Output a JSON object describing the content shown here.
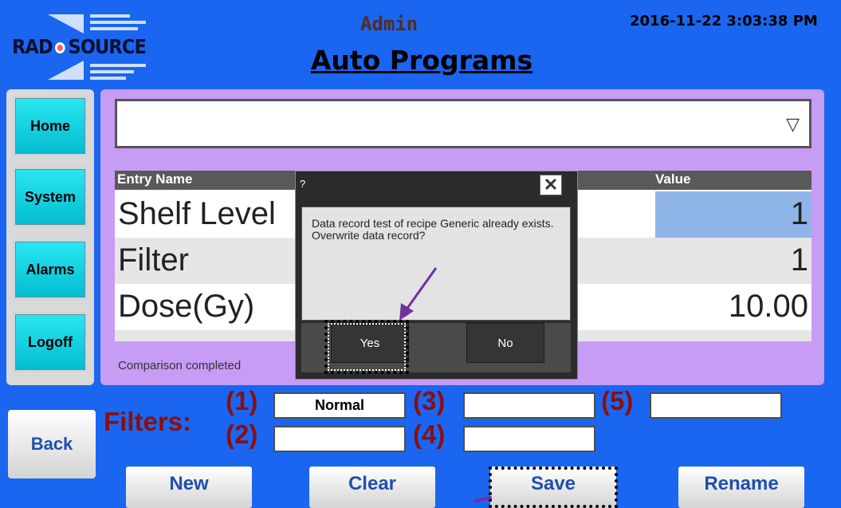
{
  "header": {
    "logo_text_left": "RAD",
    "logo_text_right": "SOURCE",
    "user": "Admin",
    "title": "Auto Programs",
    "datetime": "2016-11-22 3:03:38 PM"
  },
  "nav": [
    {
      "label": "Home"
    },
    {
      "label": "System"
    },
    {
      "label": "Alarms"
    },
    {
      "label": "Logoff"
    }
  ],
  "recipe_dropdown": {
    "value": ""
  },
  "table": {
    "headers": [
      "Entry Name",
      "Value"
    ],
    "rows": [
      {
        "name": "Shelf Level",
        "value": "1",
        "selected": true
      },
      {
        "name": "Filter",
        "value": "1"
      },
      {
        "name": "Dose(Gy)",
        "value": "10.00"
      }
    ]
  },
  "status": "Comparison completed",
  "dialog": {
    "title": "?",
    "message": "Data record test of recipe Generic already exists. Overwrite data record?",
    "yes_label": "Yes",
    "no_label": "No"
  },
  "filters": {
    "label": "Filters:",
    "slots": [
      {
        "num": "(1)",
        "value": "Normal"
      },
      {
        "num": "(2)",
        "value": ""
      },
      {
        "num": "(3)",
        "value": ""
      },
      {
        "num": "(4)",
        "value": ""
      },
      {
        "num": "(5)",
        "value": ""
      }
    ]
  },
  "buttons": {
    "back": "Back",
    "new": "New",
    "clear": "Clear",
    "save": "Save",
    "rename": "Rename"
  },
  "colors": {
    "background": "#1a66f0",
    "panel": "#c79cf5",
    "nav_button": "#04bcd1",
    "selected_cell": "#8fb4e8",
    "filter_text": "#8a0f0f",
    "button_text": "#1f4fb0",
    "annotation_arrow": "#7030a0"
  }
}
